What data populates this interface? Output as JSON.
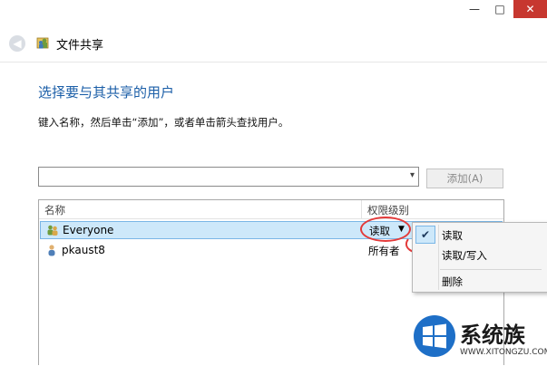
{
  "window": {
    "title": "文件共享",
    "minimize_glyph": "—",
    "maximize_glyph": "□",
    "close_glyph": "✕"
  },
  "main": {
    "heading": "选择要与其共享的用户",
    "instruction": "键入名称，然后单击“添加”，或者单击箭头查找用户。",
    "combo_value": "",
    "add_label": "添加(A)"
  },
  "table": {
    "headers": [
      "名称",
      "权限级别"
    ],
    "rows": [
      {
        "name": "Everyone",
        "permission": "读取",
        "selected": true
      },
      {
        "name": "pkaust8",
        "permission": "所有者",
        "selected": false
      }
    ]
  },
  "context_menu": {
    "items": [
      "读取",
      "读取/写入",
      "删除"
    ],
    "checked": "读取"
  },
  "watermark": {
    "text": "系统族",
    "url": "WWW.XITONGZU.COM"
  },
  "colors": {
    "accent": "#1c5fa8",
    "selection": "#cde8fa",
    "annotation_red": "#e33a3a",
    "close_red": "#c7372f"
  }
}
